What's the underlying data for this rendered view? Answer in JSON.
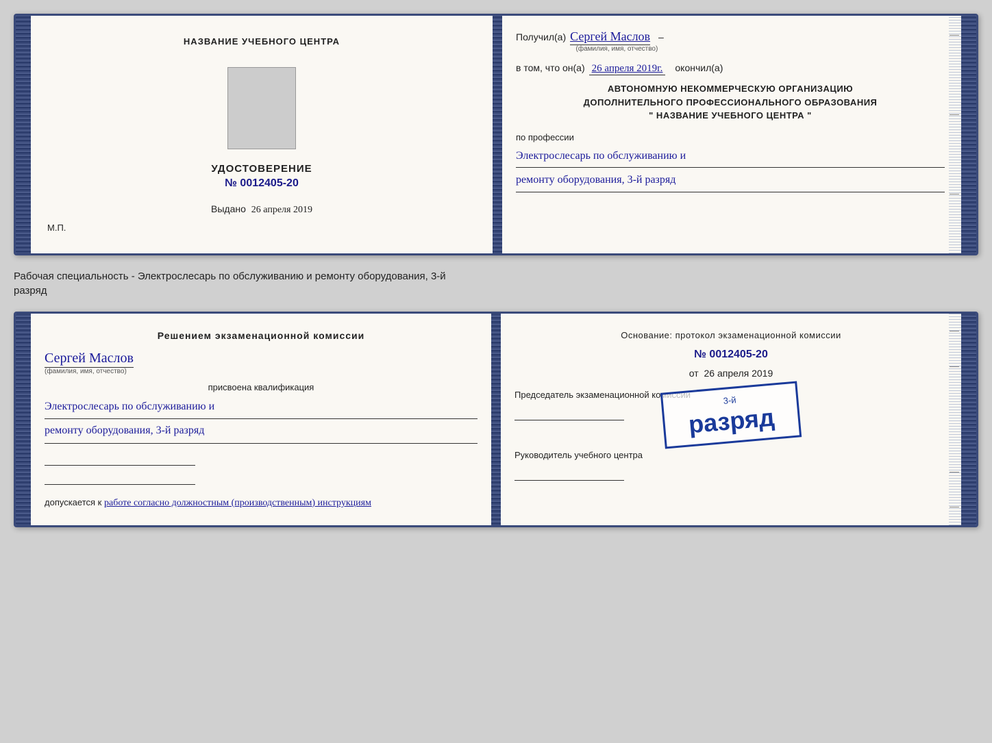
{
  "upper_card": {
    "left_page": {
      "school_name": "НАЗВАНИЕ УЧЕБНОГО ЦЕНТРА",
      "udostoverenie_label": "УДОСТОВЕРЕНИЕ",
      "number": "№ 0012405-20",
      "vydano_label": "Выдано",
      "vydano_date": "26 апреля 2019",
      "mp_label": "М.П."
    },
    "right_page": {
      "poluchil_label": "Получил(а)",
      "recipient_name": "Сергей Маслов",
      "fio_hint": "(фамилия, имя, отчество)",
      "vtom_label": "в том, что он(а)",
      "completion_date": "26 апреля 2019г.",
      "okончил_label": "окончил(а)",
      "org_line1": "АВТОНОМНУЮ НЕКОММЕРЧЕСКУЮ ОРГАНИЗАЦИЮ",
      "org_line2": "ДОПОЛНИТЕЛЬНОГО ПРОФЕССИОНАЛЬНОГО ОБРАЗОВАНИЯ",
      "org_line3": "\"  НАЗВАНИЕ УЧЕБНОГО ЦЕНТРА  \"",
      "po_professii_label": "по профессии",
      "profession_line1": "Электрослесарь по обслуживанию и",
      "profession_line2": "ремонту оборудования, 3-й разряд"
    }
  },
  "between_text": {
    "line1": "Рабочая специальность - Электрослесарь по обслуживанию и ремонту оборудования, 3-й",
    "line2": "разряд"
  },
  "lower_card": {
    "left_page": {
      "resheniem_label": "Решением экзаменационной комиссии",
      "fio_name": "Сергей Маслов",
      "fio_hint": "(фамилия, имя, отчество)",
      "prisvoena_label": "присвоена квалификация",
      "qual_line1": "Электрослесарь по обслуживанию и",
      "qual_line2": "ремонту оборудования, 3-й разряд",
      "dopuskaetsya_label": "допускается к",
      "dopuskaetsya_value": "работе согласно должностным (производственным) инструкциям"
    },
    "right_page": {
      "osnovanie_label": "Основание: протокол экзаменационной комиссии",
      "protokol_num": "№  0012405-20",
      "ot_label": "от",
      "ot_date": "26 апреля 2019",
      "predsedatel_label": "Председатель экзаменационной комиссии",
      "rukovoditel_label": "Руководитель учебного центра",
      "stamp_line1": "3-й разряд"
    }
  }
}
